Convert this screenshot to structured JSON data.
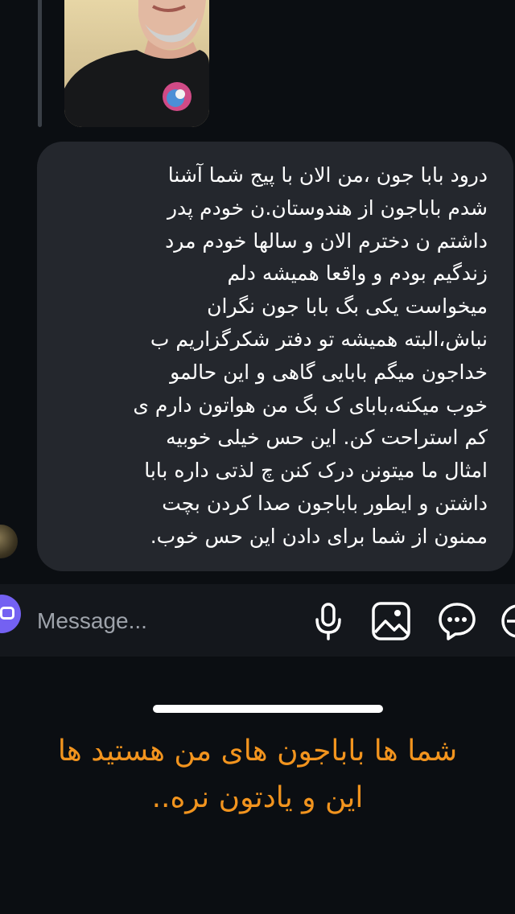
{
  "message": {
    "text": "درود بابا جون ،من الان با پیج شما آشنا\nشدم باباجون از هندوستان.ن خودم پدر\nداشتم ن دخترم الان و سالها خودم مرد\nزندگیم بودم و واقعا همیشه دلم\nمیخواست یکی بگ بابا جون نگران\nنباش،البته همیشه تو دفتر شکرگزاریم ب\nخداجون میگم بابایی گاهی و این حالمو\nخوب میکنه،بابای ک بگ من هواتون دارم ی\nکم استراحت کن. این حس خیلی خوبیه\nامثال ما میتونن درک کنن چ لذتی داره بابا\nداشتن و ایطور باباجون صدا کردن بچت\nممنون از شما برای دادن این حس خوب."
  },
  "composer": {
    "placeholder": "Message..."
  },
  "caption": {
    "text": "شما ها باباجون های من هستید ها\nاین و یادتون نره.."
  },
  "icons": {
    "camera": "camera-icon",
    "microphone": "microphone-icon",
    "gallery": "image-icon",
    "sticker": "chat-bubble-icon",
    "add": "plus-circle-icon"
  },
  "colors": {
    "background": "#0b0e12",
    "bubble": "#24272d",
    "composer": "#14171c",
    "camera_button": "#7461f2",
    "caption": "#f2941e"
  }
}
